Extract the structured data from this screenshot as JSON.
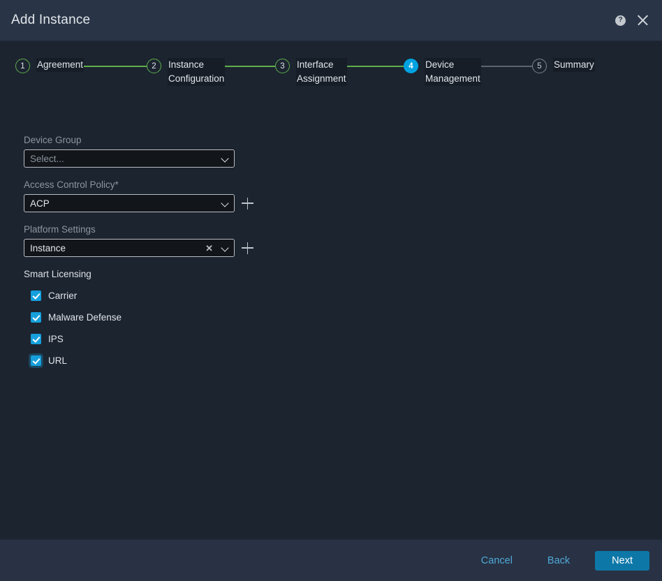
{
  "header": {
    "title": "Add Instance",
    "help_icon": "help-circle-icon",
    "help_glyph": "?",
    "close_icon": "close-icon"
  },
  "stepper": {
    "steps": [
      {
        "number": "1",
        "label": "Agreement",
        "state": "complete"
      },
      {
        "number": "2",
        "label": "Instance\nConfiguration",
        "state": "complete"
      },
      {
        "number": "3",
        "label": "Interface\nAssignment",
        "state": "complete"
      },
      {
        "number": "4",
        "label": "Device\nManagement",
        "state": "active"
      },
      {
        "number": "5",
        "label": "Summary",
        "state": "pending"
      }
    ],
    "complete_color": "#5fae4a",
    "active_color": "#00a3e0",
    "pending_color": "#7b848f"
  },
  "form": {
    "device_group": {
      "label": "Device Group",
      "value": "Select...",
      "is_placeholder": true
    },
    "access_control_policy": {
      "label": "Access Control Policy*",
      "value": "ACP",
      "add_icon": "plus-icon"
    },
    "platform_settings": {
      "label": "Platform Settings",
      "value": "Instance",
      "clear_glyph": "✕",
      "add_icon": "plus-icon"
    },
    "smart_licensing": {
      "label": "Smart Licensing",
      "items": [
        {
          "label": "Carrier",
          "checked": true,
          "focused": false
        },
        {
          "label": "Malware Defense",
          "checked": true,
          "focused": false
        },
        {
          "label": "IPS",
          "checked": true,
          "focused": false
        },
        {
          "label": "URL",
          "checked": true,
          "focused": true
        }
      ],
      "checkbox_color": "#15a0dd"
    }
  },
  "footer": {
    "cancel_label": "Cancel",
    "back_label": "Back",
    "next_label": "Next",
    "link_color": "#4fa8d8",
    "primary_color": "#0d78a8"
  }
}
